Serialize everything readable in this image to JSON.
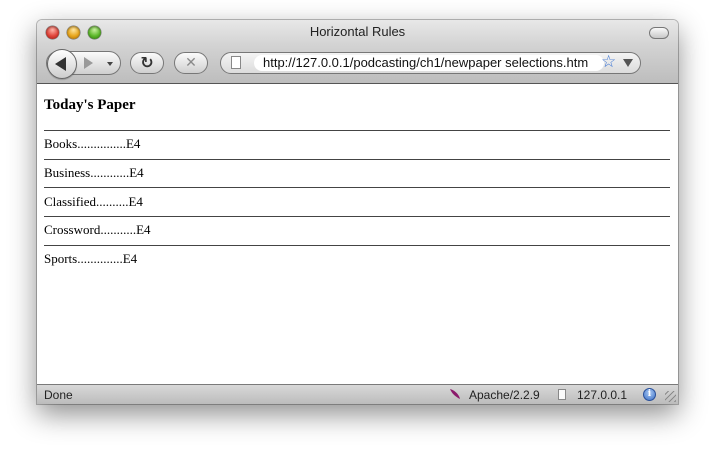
{
  "window": {
    "title": "Horizontal Rules"
  },
  "toolbar": {
    "back_icon": "back-arrow-icon",
    "forward_icon": "forward-arrow-icon",
    "reload_glyph": "↻",
    "stop_glyph": "✕",
    "url": "http://127.0.0.1/podcasting/ch1/newpaper selections.htm",
    "bookmark_glyph": "☆"
  },
  "page": {
    "heading": "Today's Paper",
    "sections": [
      {
        "label": "Books...............E4"
      },
      {
        "label": "Business............E4"
      },
      {
        "label": "Classified..........E4"
      },
      {
        "label": "Crossword...........E4"
      },
      {
        "label": "Sports..............E4"
      }
    ]
  },
  "statusbar": {
    "status": "Done",
    "server": "Apache/2.2.9",
    "host": "127.0.0.1",
    "info_glyph": "i"
  },
  "colors": {
    "star": "#3b74d4",
    "feather": "#8b1a6b"
  }
}
